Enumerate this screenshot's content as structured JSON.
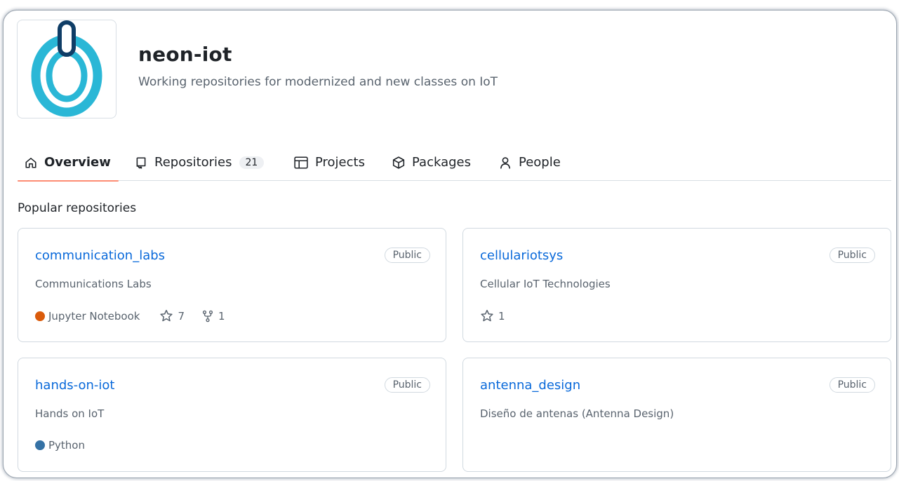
{
  "org": {
    "name": "neon-iot",
    "description": "Working repositories for modernized and new classes on IoT",
    "logo_colors": {
      "ring": "#2ab7d6",
      "handle_fill": "#ffffff",
      "handle_stroke": "#0f3d66"
    }
  },
  "tabs": [
    {
      "label": "Overview",
      "icon": "home-icon",
      "active": true
    },
    {
      "label": "Repositories",
      "icon": "repo-icon",
      "count": "21"
    },
    {
      "label": "Projects",
      "icon": "table-icon"
    },
    {
      "label": "Packages",
      "icon": "package-icon"
    },
    {
      "label": "People",
      "icon": "person-icon"
    }
  ],
  "popular": {
    "title": "Popular repositories",
    "repos": [
      {
        "name": "communication_labs",
        "visibility": "Public",
        "description": "Communications Labs",
        "language": "Jupyter Notebook",
        "language_color": "#DA5B0B",
        "stars": "7",
        "forks": "1"
      },
      {
        "name": "cellulariotsys",
        "visibility": "Public",
        "description": "Cellular IoT Technologies",
        "stars": "1"
      },
      {
        "name": "hands-on-iot",
        "visibility": "Public",
        "description": "Hands on IoT",
        "language": "Python",
        "language_color": "#3572A5"
      },
      {
        "name": "antenna_design",
        "visibility": "Public",
        "description": "Diseño de antenas (Antenna Design)"
      }
    ]
  },
  "colors": {
    "link": "#0969da",
    "tab_underline": "#fd8c73",
    "muted_text": "#59636e"
  }
}
